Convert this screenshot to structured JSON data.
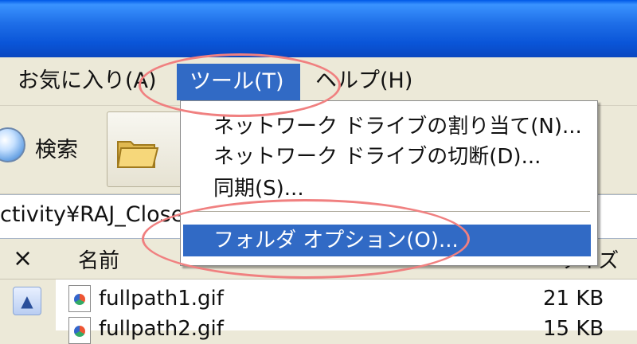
{
  "menubar": {
    "favorites": "お気に入り(A)",
    "tools": "ツール(T)",
    "help": "ヘルプ(H)"
  },
  "toolbar": {
    "search_label": "検索"
  },
  "address": {
    "text": "ctivity¥RAJ_Close"
  },
  "list": {
    "close": "×",
    "col_name": "名前",
    "col_size": "サイズ",
    "files": [
      {
        "name": "fullpath1.gif",
        "size": "21 KB"
      },
      {
        "name": "fullpath2.gif",
        "size": "15 KB"
      }
    ]
  },
  "tools_menu": {
    "items": [
      "ネットワーク ドライブの割り当て(N)...",
      "ネットワーク ドライブの切断(D)...",
      "同期(S)...",
      "フォルダ オプション(O)..."
    ]
  },
  "colors": {
    "highlight": "#316ac5",
    "annotation_ring": "#f08080",
    "titlebar": "#0a55d8"
  },
  "icons": [
    "search-icon",
    "folders-icon",
    "file-gif-icon",
    "scroll-up-icon"
  ]
}
